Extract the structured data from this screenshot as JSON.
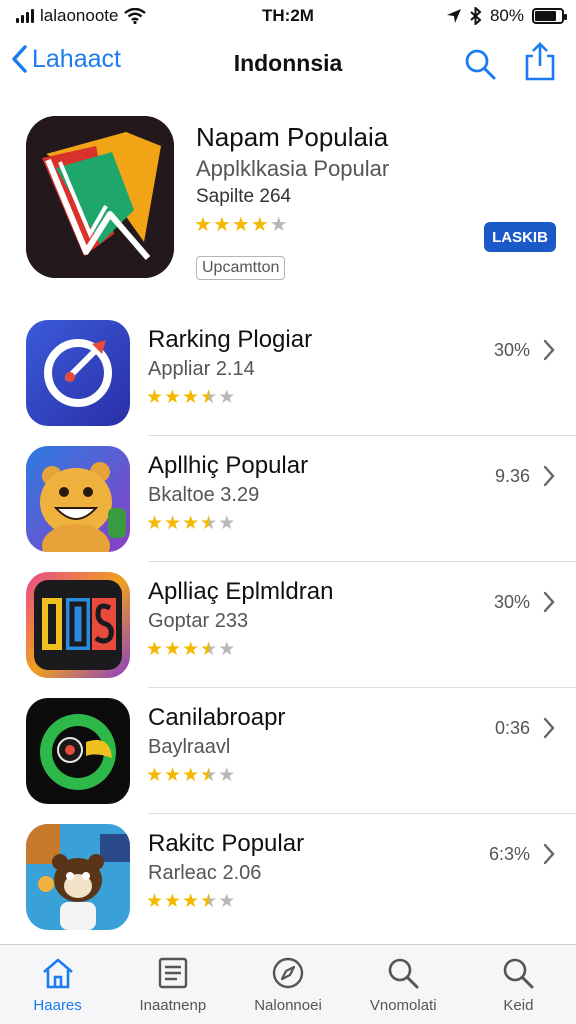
{
  "status_bar": {
    "carrier": "lalaonoote",
    "time": "TH:2M",
    "battery": "80%",
    "battery_level": 0.8,
    "icons": [
      "signal-icon",
      "wifi-icon",
      "location-icon",
      "bluetooth-icon",
      "battery-icon"
    ]
  },
  "nav": {
    "back_label": "Lahaact",
    "title": "Indonnsia",
    "icons": [
      "back-chevron-icon",
      "search-icon",
      "share-icon"
    ]
  },
  "featured": {
    "title": "Napam Populaia",
    "subtitle": "Applklkasia Popular",
    "size": "Sapilte 264",
    "rating": 4,
    "tag": "Upcamtton",
    "button_label": "LASKIB",
    "colors": {
      "button": "#1b59c8",
      "icon_bg": "#23191d"
    }
  },
  "apps": [
    {
      "title": "Rarking Plogiar",
      "subtitle": "Appliar 2.14",
      "rating": 3.5,
      "value": "30%",
      "icon": "rocket-circle-icon"
    },
    {
      "title": "Apllhiç Popular",
      "subtitle": "Bkaltoe 3.29",
      "rating": 3.5,
      "value": "9.36",
      "icon": "bear-mascot-icon"
    },
    {
      "title": "Aplliaç Eplmldran",
      "subtitle": "Goptar 233",
      "rating": 3.5,
      "value": "30%",
      "icon": "letters-tile-icon"
    },
    {
      "title": "Canilabroapr",
      "subtitle": "Baylraavl",
      "rating": 3.5,
      "value": "0:36",
      "icon": "green-eye-icon"
    },
    {
      "title": "Rakitc Popular",
      "subtitle": "Rarleac 2.06",
      "rating": 3.5,
      "value": "6:3%",
      "icon": "hamster-mascot-icon"
    }
  ],
  "tabs": [
    {
      "label": "Haares",
      "icon": "home-icon",
      "active": true
    },
    {
      "label": "Inaatnenp",
      "icon": "list-icon",
      "active": false
    },
    {
      "label": "Nalonnoei",
      "icon": "compass-icon",
      "active": false
    },
    {
      "label": "Vnomolati",
      "icon": "search-icon",
      "active": false
    },
    {
      "label": "Keid",
      "icon": "search-icon",
      "active": false
    }
  ],
  "colors": {
    "accent": "#1a7cf0",
    "star": "#f5b800",
    "star_empty": "#b8b8b8"
  }
}
